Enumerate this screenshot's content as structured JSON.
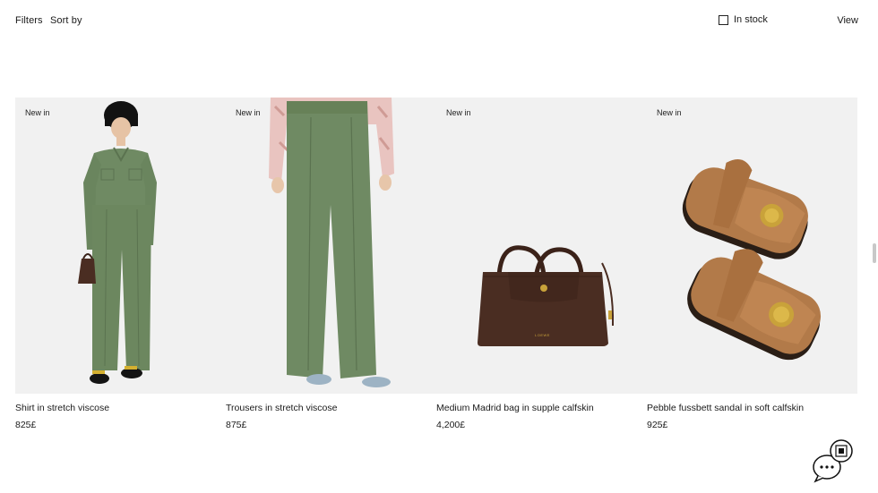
{
  "toolbar": {
    "filters_label": "Filters",
    "sortby_label": "Sort by",
    "instock_label": "In stock",
    "view_label": "View"
  },
  "products": [
    {
      "badge": "New in",
      "name": "Shirt in stretch viscose",
      "price": "825£"
    },
    {
      "badge": "New in",
      "name": "Trousers in stretch viscose",
      "price": "875£"
    },
    {
      "badge": "New in",
      "name": "Medium Madrid bag in supple calfskin",
      "price": "4,200£"
    },
    {
      "badge": "New in",
      "name": "Pebble fussbett sandal in soft calfskin",
      "price": "925£"
    }
  ],
  "product_images": [
    "model-in-green-outfit",
    "green-trousers",
    "brown-leather-bag",
    "tan-sandals"
  ],
  "bag_logo": "LOEWE",
  "colors": {
    "image_bg": "#f1f1f1",
    "outfit_green": "#6f8a63",
    "bag_brown": "#4a2d22",
    "sandal_tan": "#b27a49",
    "buckle_gold": "#c9a23a"
  }
}
